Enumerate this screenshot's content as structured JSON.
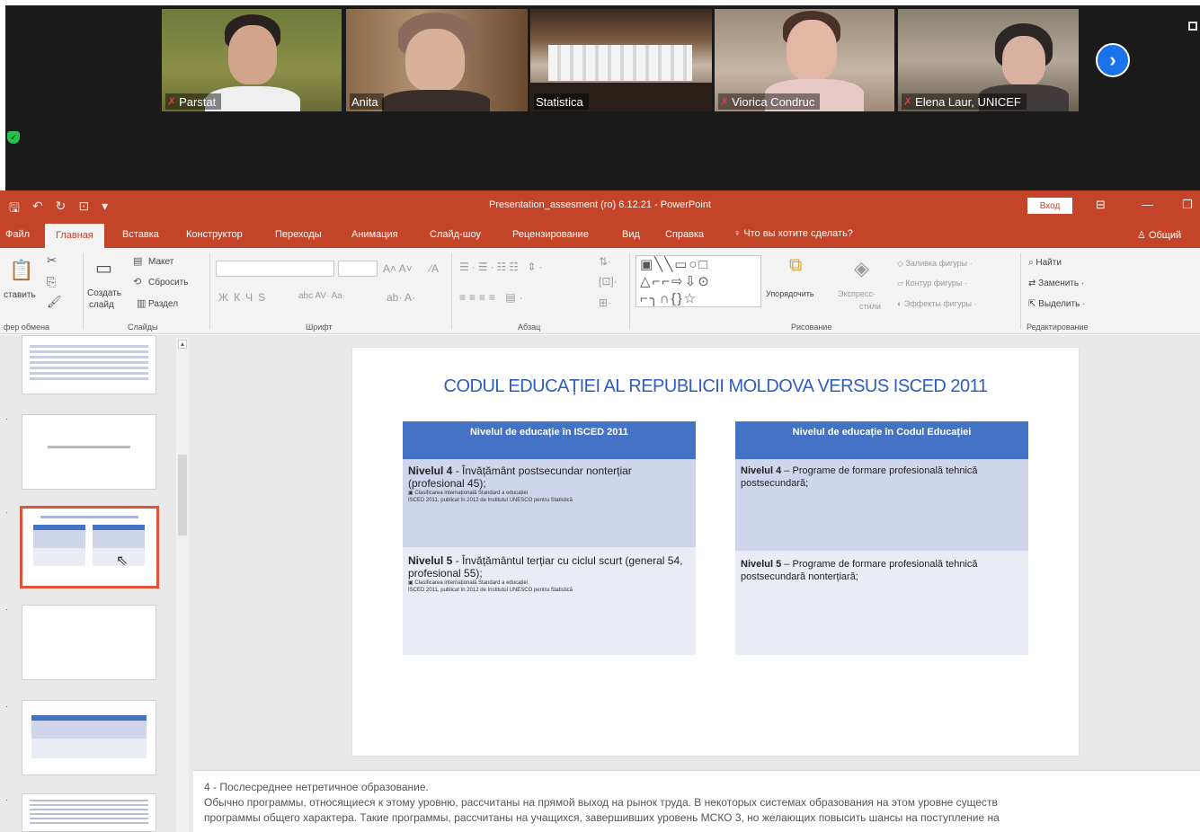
{
  "participants": [
    {
      "name": "Parstat",
      "muted": true
    },
    {
      "name": "Anita",
      "muted": false,
      "active": true
    },
    {
      "name": "Statistica",
      "muted": false
    },
    {
      "name": "Viorica Condruc",
      "muted": true
    },
    {
      "name": "Elena Laur, UNICEF",
      "muted": true
    }
  ],
  "app": {
    "title": "Presentation_assesment (ro) 6.12.21  -  PowerPoint",
    "signin": "Вход"
  },
  "tabs": [
    "Файл",
    "Главная",
    "Вставка",
    "Конструктор",
    "Переходы",
    "Анимация",
    "Слайд-шоу",
    "Рецензирование",
    "Вид",
    "Справка"
  ],
  "tell_me": "Что вы хотите сделать?",
  "share": "Общий",
  "ribbon": {
    "clipboard_paste": "ставить",
    "clipboard_label": "фер обмена",
    "new_slide_1": "Создать",
    "new_slide_2": "слайд",
    "layout": "Макет",
    "reset": "Сбросить",
    "section": "Раздел",
    "slides_label": "Слайды",
    "font_label": "Шрифт",
    "paragraph_label": "Абзац",
    "arrange": "Упорядочить",
    "quick_styles_1": "Экспресс-",
    "quick_styles_2": "стили",
    "shape_fill": "Заливка фигуры",
    "shape_outline": "Контур фигуры",
    "shape_effects": "Эффекты фигуры",
    "drawing_label": "Рисование",
    "find": "Найти",
    "replace": "Заменить",
    "select": "Выделить",
    "editing_label": "Редактирование"
  },
  "slide": {
    "title": "CODUL EDUCAȚIEI AL REPUBLICII MOLDOVA VERSUS  ISCED 2011",
    "left": {
      "header": "Nivelul de educație în ISCED 2011",
      "c1_level": "Nivelul 4",
      "c1_text": " - Învățământ postsecundar nonterțiar (profesional 45);",
      "c1_small1": "Clasificarea internațională Standard a educației",
      "c1_small2": "ISCED 2011, publicat în 2012 de  Institutul UNESCO pentru Statistică",
      "c2_level": "Nivelul 5",
      "c2_text": " - Învățământul terțiar cu ciclul scurt (general 54, profesional 55);",
      "c2_small1": "Clasificarea internațională Standard a educației",
      "c2_small2": "ISCED 2011, publicat în 2012 de  Institutul UNESCO pentru Statistică"
    },
    "right": {
      "header": "Nivelul de educație în Codul Educației",
      "c1_level": "Nivelul 4",
      "c1_text": " – Programe de formare profesională tehnică postsecundară;",
      "c2_level": "Nivelul 5",
      "c2_text": " –  Programe de formare profesională tehnică postsecundară nonterțiară;"
    }
  },
  "notes": {
    "line1": "4 - Послесреднее нетретичное образование.",
    "line2": "Обычно программы, относящиеся к этому уровню, рассчитаны на прямой выход на рынок труда. В некоторых системах образования на этом уровне существ",
    "line3": "программы общего характера. Такие программы, рассчитаны на учащихся, завершивших уровень МСКО 3, но желающих повысить шансы на поступление на"
  }
}
